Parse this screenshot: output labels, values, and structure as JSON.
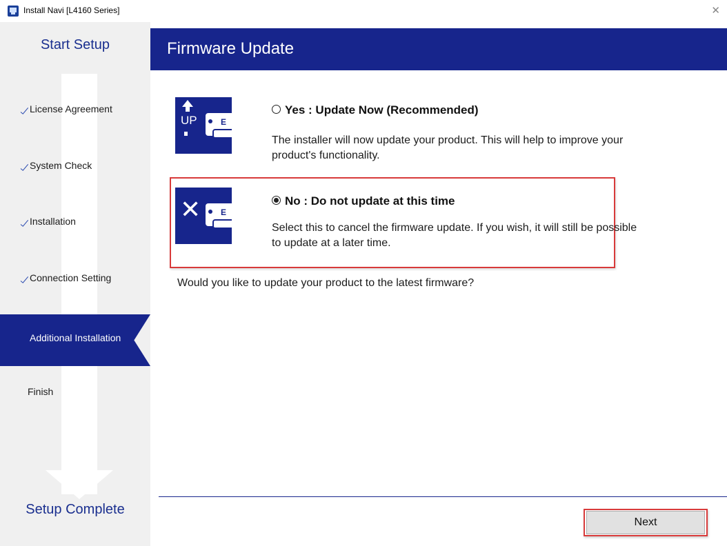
{
  "window": {
    "title": "Install Navi [L4160 Series]",
    "close_glyph": "✕",
    "accent_color": "#17258c",
    "highlight_color": "#d83a3a"
  },
  "sidebar": {
    "start_label": "Start Setup",
    "complete_label": "Setup Complete",
    "steps": [
      {
        "label": "License Agreement",
        "state": "done"
      },
      {
        "label": "System Check",
        "state": "done"
      },
      {
        "label": "Installation",
        "state": "done"
      },
      {
        "label": "Connection Setting",
        "state": "done"
      },
      {
        "label": "Additional Installation",
        "state": "active"
      },
      {
        "label": "Finish",
        "state": "pending"
      }
    ]
  },
  "header": {
    "title": "Firmware Update"
  },
  "options": {
    "yes": {
      "title": "Yes : Update Now (Recommended)",
      "description": "The installer will now update your product. This will help to improve your product's functionality.",
      "selected": false,
      "icon": "update-up-icon",
      "icon_text": "UP",
      "printer_text": "E"
    },
    "no": {
      "title": "No : Do not update at this time",
      "description": "Select this to cancel the firmware update.  If you wish, it will still be possible to update at a later time.",
      "selected": true,
      "icon": "cancel-x-icon",
      "icon_glyph": "✕",
      "printer_text": "E"
    }
  },
  "question": "Would you like to update your product to the latest firmware?",
  "footer": {
    "next_label": "Next"
  }
}
